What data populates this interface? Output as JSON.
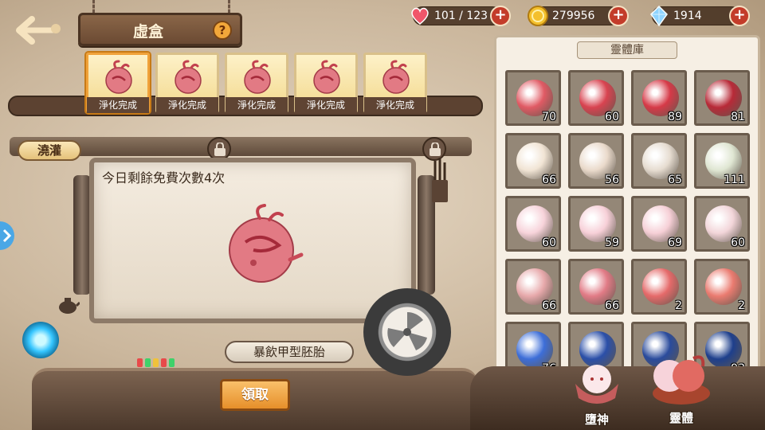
{
  "header": {
    "title": "虛盒",
    "help_label": "?",
    "back_icon": "back-arrow-icon"
  },
  "resources": [
    {
      "name": "stamina",
      "icon": "heart-icon",
      "value": "101 / 123",
      "color": "#f0566a"
    },
    {
      "name": "gold",
      "icon": "coin-icon",
      "value": "279956",
      "color": "#f4c02c"
    },
    {
      "name": "crystal",
      "icon": "crystal-icon",
      "value": "1914",
      "color": "#8fd4ff"
    }
  ],
  "plus_label": "+",
  "slots": [
    {
      "label": "淨化完成",
      "selected": true
    },
    {
      "label": "淨化完成",
      "selected": false
    },
    {
      "label": "淨化完成",
      "selected": false
    },
    {
      "label": "淨化完成",
      "selected": false
    },
    {
      "label": "淨化完成",
      "selected": false
    }
  ],
  "chamber": {
    "tag": "澆灌",
    "free_text": "今日剩餘免費次數4次",
    "creature_name": "暴飲甲型胚胎",
    "claim_label": "領取"
  },
  "storage": {
    "title": "靈體庫",
    "items": [
      {
        "count": "70",
        "color": "#e05a64"
      },
      {
        "count": "60",
        "color": "#d84350"
      },
      {
        "count": "89",
        "color": "#d63a48"
      },
      {
        "count": "81",
        "color": "#b82a38"
      },
      {
        "count": "66",
        "color": "#f1e4d4"
      },
      {
        "count": "56",
        "color": "#eadacb"
      },
      {
        "count": "65",
        "color": "#e6dcd0"
      },
      {
        "count": "111",
        "color": "#dfe6d2"
      },
      {
        "count": "60",
        "color": "#f7d3da"
      },
      {
        "count": "59",
        "color": "#f7d0d8"
      },
      {
        "count": "69",
        "color": "#f6cfd6"
      },
      {
        "count": "60",
        "color": "#f2d5d9"
      },
      {
        "count": "66",
        "color": "#e7a9ab"
      },
      {
        "count": "66",
        "color": "#e17b86"
      },
      {
        "count": "2",
        "color": "#e56a6a"
      },
      {
        "count": "2",
        "color": "#ea7b70"
      },
      {
        "count": "76",
        "color": "#3d6ed8"
      },
      {
        "count": "",
        "color": "#2b4fa8"
      },
      {
        "count": "",
        "color": "#2a4b9c"
      },
      {
        "count": "93",
        "color": "#1e3f8c"
      }
    ]
  },
  "bottom_tabs": [
    {
      "label": "墮神"
    },
    {
      "label": "靈體"
    }
  ],
  "status_lights": [
    "#e84a4a",
    "#3fd16a",
    "#f0c23a",
    "#e84a4a",
    "#3fd16a"
  ]
}
